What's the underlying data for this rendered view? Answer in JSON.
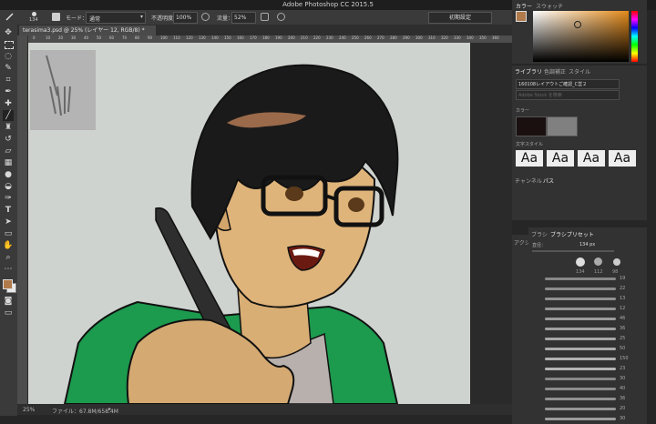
{
  "app": {
    "title": "Adobe Photoshop CC 2015.5"
  },
  "options_bar": {
    "brush_size": "134",
    "mode_label": "モード：",
    "mode_value": "通常",
    "opacity_label": "不透明度：",
    "opacity_value": "100%",
    "flow_label": "流量：",
    "flow_value": "52%",
    "workspace": "初期設定"
  },
  "document": {
    "tab_title": "terasima3.psd @ 25% (レイヤー 12, RGB/8) *",
    "zoom": "25%",
    "file_info": "ファイル：67.8M/658.4M"
  },
  "ruler_ticks": [
    "0",
    "10",
    "20",
    "30",
    "40",
    "50",
    "60",
    "70",
    "80",
    "90",
    "100",
    "110",
    "120",
    "130",
    "140",
    "150",
    "160",
    "170",
    "180",
    "190",
    "200",
    "210",
    "220",
    "230",
    "240",
    "250",
    "260",
    "270",
    "280",
    "290",
    "300",
    "310",
    "320",
    "330",
    "340",
    "350",
    "360"
  ],
  "color_panel": {
    "tabs": [
      "カラー",
      "スウォッチ"
    ],
    "hue_colors": [
      "#ff0000",
      "#ff00ff",
      "#0000ff",
      "#00ffff",
      "#00ff00",
      "#ffff00",
      "#ff0000"
    ],
    "field_color": "#e38a1a"
  },
  "library_panel": {
    "tabs": [
      "ライブラリ",
      "色調補正",
      "スタイル"
    ],
    "library_name": "160108レイアウトご確認_C営２",
    "search_placeholder": "Adobe Stock を検索",
    "colors_header": "カラー",
    "swatches": [
      "#1a1010",
      "#808080"
    ],
    "text_styles_header": "文字スタイル",
    "text_style_sample": "Aa"
  },
  "channels_panel": {
    "tabs": [
      "チャンネル",
      "パス"
    ]
  },
  "brush_panel": {
    "tabs": [
      "ブラシ",
      "ブラシプリセット"
    ],
    "size_label": "直径：",
    "size_value": "134 px",
    "presets": [
      "134",
      "112",
      "98"
    ],
    "sizes": [
      "19",
      "22",
      "13",
      "12",
      "46",
      "36",
      "25",
      "50",
      "150",
      "23",
      "30",
      "40",
      "36",
      "20",
      "30"
    ]
  },
  "actions_panel": {
    "tab": "アクシ"
  }
}
